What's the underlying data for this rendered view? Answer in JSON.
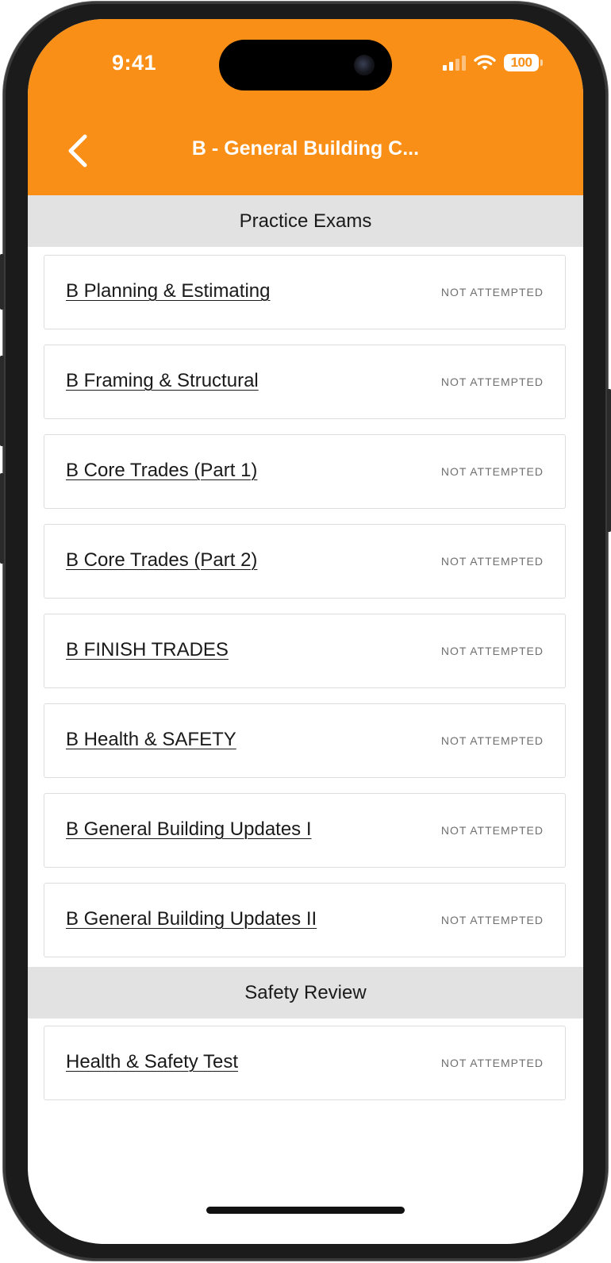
{
  "status_bar": {
    "time": "9:41",
    "battery": "100"
  },
  "nav": {
    "title": "B - General Building C...",
    "back_icon": "chevron-left-icon"
  },
  "colors": {
    "header": "#f98f16",
    "section_bg": "#e2e2e2"
  },
  "sections": [
    {
      "label": "Practice Exams",
      "items": [
        {
          "title": "B Planning & Estimating",
          "status": "NOT ATTEMPTED"
        },
        {
          "title": "B Framing & Structural",
          "status": "NOT ATTEMPTED"
        },
        {
          "title": "B Core Trades (Part 1)",
          "status": "NOT ATTEMPTED"
        },
        {
          "title": "B Core Trades (Part 2)",
          "status": "NOT ATTEMPTED"
        },
        {
          "title": "B FINISH TRADES",
          "status": "NOT ATTEMPTED"
        },
        {
          "title": "B Health & SAFETY",
          "status": "NOT ATTEMPTED"
        },
        {
          "title": "B General Building Updates I",
          "status": "NOT ATTEMPTED"
        },
        {
          "title": "B General Building Updates II",
          "status": "NOT ATTEMPTED"
        }
      ]
    },
    {
      "label": "Safety Review",
      "items": [
        {
          "title": "Health & Safety Test",
          "status": "NOT ATTEMPTED"
        }
      ]
    }
  ]
}
